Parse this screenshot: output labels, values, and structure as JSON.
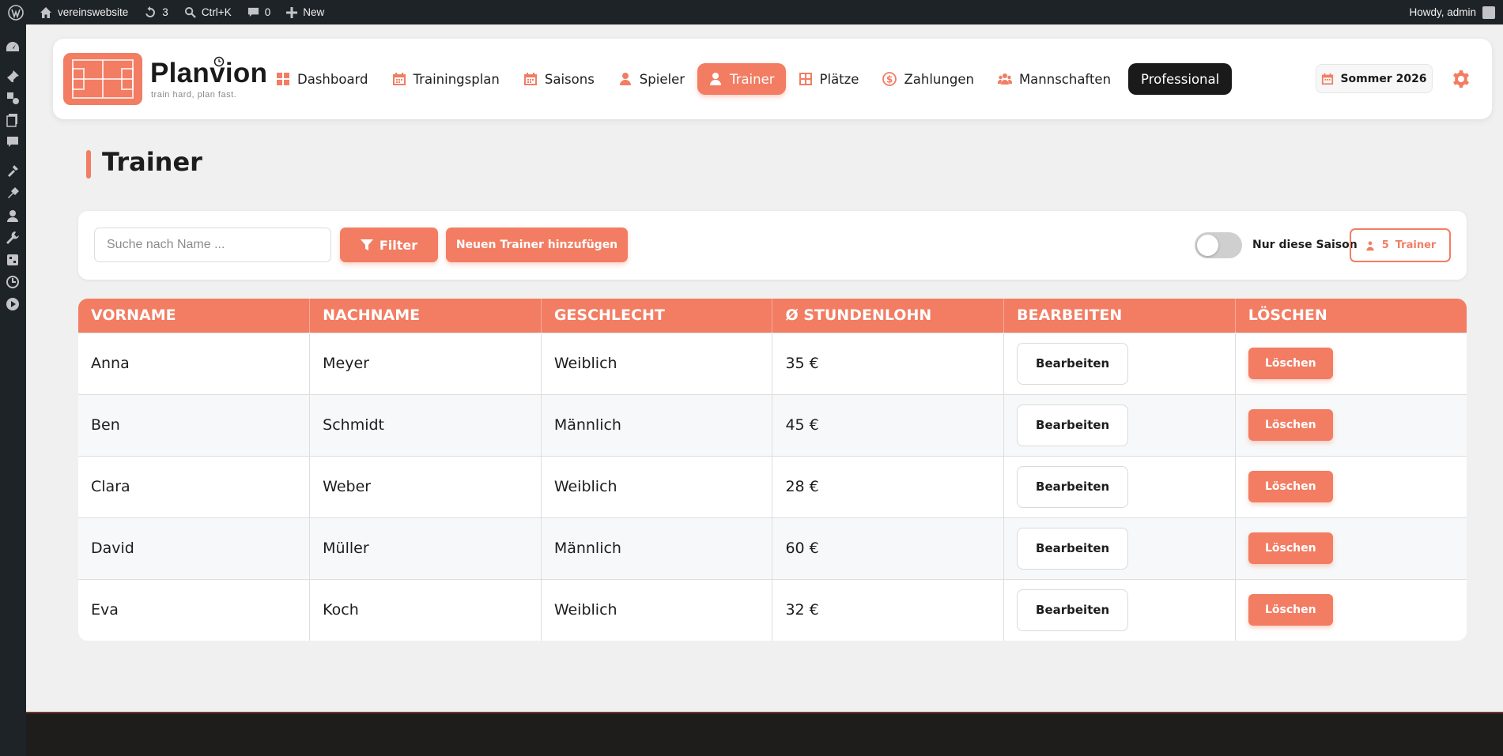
{
  "adminbar": {
    "site_name": "vereinswebsite",
    "updates_count": "3",
    "search_shortcut": "Ctrl+K",
    "comments_count": "0",
    "new_label": "New",
    "greeting": "Howdy, admin"
  },
  "sidebar_icons": [
    "dashboard-icon",
    "pin-icon",
    "media-icon",
    "pages-icon",
    "comments-icon",
    "appearance-icon",
    "plugins-icon",
    "users-icon",
    "tools-icon",
    "settings-icon",
    "clock-icon",
    "play-icon"
  ],
  "brand": {
    "name": "Planvion",
    "tagline": "train hard, plan fast.",
    "accent": "#f27d63"
  },
  "nav": {
    "items": [
      {
        "label": "Dashboard",
        "icon": "grid-icon"
      },
      {
        "label": "Trainingsplan",
        "icon": "calendar-icon"
      },
      {
        "label": "Saisons",
        "icon": "calendar-icon"
      },
      {
        "label": "Spieler",
        "icon": "user-icon"
      },
      {
        "label": "Trainer",
        "icon": "user-icon",
        "active": true
      },
      {
        "label": "Plätze",
        "icon": "field-icon"
      },
      {
        "label": "Zahlungen",
        "icon": "dollar-icon"
      },
      {
        "label": "Mannschaften",
        "icon": "team-icon"
      }
    ],
    "pro_label": "Professional"
  },
  "season": {
    "label": "Sommer 2026"
  },
  "page": {
    "title": "Trainer"
  },
  "toolbar": {
    "search_placeholder": "Suche nach Name ...",
    "filter_label": "Filter",
    "add_label": "Neuen Trainer hinzufügen",
    "toggle_label": "Nur diese Saison",
    "toggle_on": false,
    "count_value": "5",
    "count_label": "Trainer"
  },
  "table": {
    "headers": [
      "VORNAME",
      "NACHNAME",
      "GESCHLECHT",
      "Ø STUNDENLOHN",
      "BEARBEITEN",
      "LÖSCHEN"
    ],
    "rows": [
      {
        "first": "Anna",
        "last": "Meyer",
        "gender": "Weiblich",
        "wage": "35 €"
      },
      {
        "first": "Ben",
        "last": "Schmidt",
        "gender": "Männlich",
        "wage": "45 €"
      },
      {
        "first": "Clara",
        "last": "Weber",
        "gender": "Weiblich",
        "wage": "28 €"
      },
      {
        "first": "David",
        "last": "Müller",
        "gender": "Männlich",
        "wage": "60 €"
      },
      {
        "first": "Eva",
        "last": "Koch",
        "gender": "Weiblich",
        "wage": "32 €"
      }
    ],
    "edit_label": "Bearbeiten",
    "delete_label": "Löschen"
  }
}
